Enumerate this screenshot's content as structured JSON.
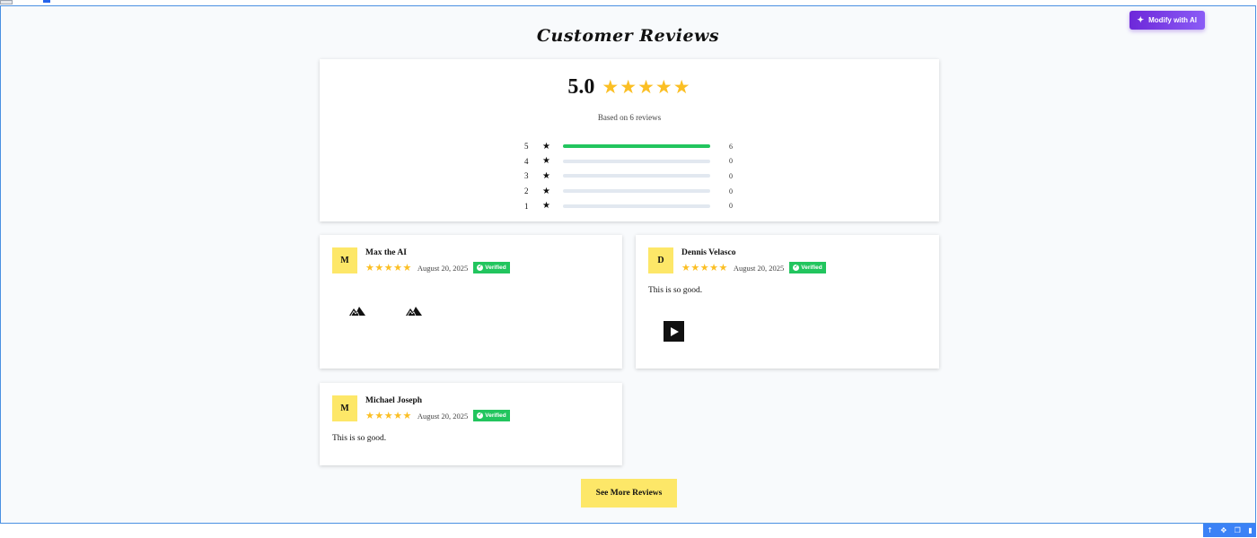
{
  "page": {
    "title": "Customer Reviews",
    "modify_ai_label": "Modify with AI"
  },
  "summary": {
    "average": "5.0",
    "stars": "★★★★★",
    "based_on": "Based on 6 reviews",
    "breakdown": [
      {
        "label": "5",
        "count": "6",
        "fraction": 1.0
      },
      {
        "label": "4",
        "count": "0",
        "fraction": 0
      },
      {
        "label": "3",
        "count": "0",
        "fraction": 0
      },
      {
        "label": "2",
        "count": "0",
        "fraction": 0
      },
      {
        "label": "1",
        "count": "0",
        "fraction": 0
      }
    ]
  },
  "reviews": [
    {
      "initial": "M",
      "name": "Max the AI",
      "stars": "★★★★★",
      "date": "August 20, 2025",
      "verified": "Verified",
      "text": ""
    },
    {
      "initial": "D",
      "name": "Dennis Velasco",
      "stars": "★★★★★",
      "date": "August 20, 2025",
      "verified": "Verified",
      "text": "This is so good."
    },
    {
      "initial": "M",
      "name": "Michael Joseph",
      "stars": "★★★★★",
      "date": "August 20, 2025",
      "verified": "Verified",
      "text": "This is so good."
    }
  ],
  "see_more_label": "See More Reviews",
  "colors": {
    "accent_yellow": "#fde768",
    "star": "#fbbf24",
    "verified": "#22c55e",
    "ai_button": "#7c3aed"
  },
  "toolbar_icons": [
    "arrow-up-icon",
    "move-icon",
    "copy-icon",
    "delete-icon"
  ]
}
